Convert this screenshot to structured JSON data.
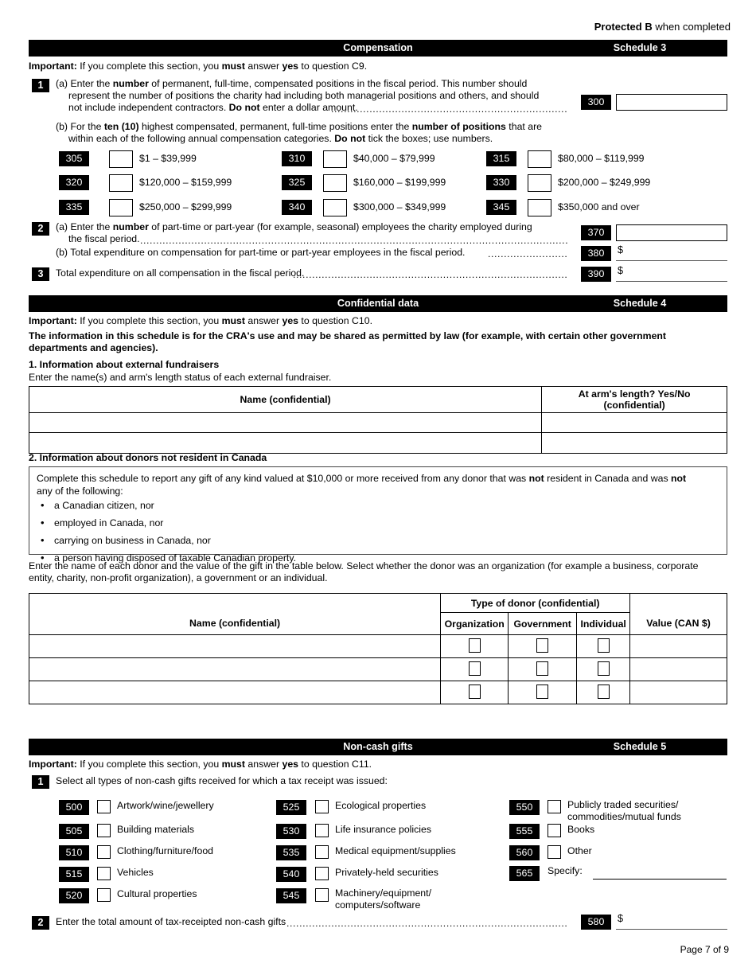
{
  "header": {
    "protected_bold": "Protected B",
    "protected_rest": " when completed"
  },
  "schedule3": {
    "bar_title": "Compensation",
    "bar_right": "Schedule 3",
    "important_bold": "Important:",
    "important_text_1": " If you complete this section, you ",
    "important_must": "must",
    "important_text_2": " answer ",
    "important_yes": "yes",
    "important_text_3": " to question C9.",
    "q1_marker": "1",
    "q1a_line1_pre": "(a) Enter the ",
    "q1a_number": "number",
    "q1a_line1_post": " of permanent, full-time, compensated positions in the fiscal period. This number should",
    "q1a_line2": "represent the number of positions the charity had including both managerial positions and others, and should",
    "q1a_line3_pre": "not include independent contractors. ",
    "q1a_donot": "Do not",
    "q1a_line3_post": " enter a dollar amount.",
    "q1a_code": "300",
    "q1b_line1_pre": "(b) For the ",
    "q1b_ten": "ten (10)",
    "q1b_line1_mid": " highest compensated, permanent, full-time positions enter the ",
    "q1b_numpos": "number of positions",
    "q1b_line1_post": " that are",
    "q1b_line2_pre": "within each of the following annual compensation categories. ",
    "q1b_donot": "Do not",
    "q1b_line2_post": " tick the boxes; use numbers.",
    "brackets": [
      {
        "code": "305",
        "label": "$1 – $39,999"
      },
      {
        "code": "310",
        "label": "$40,000 – $79,999"
      },
      {
        "code": "315",
        "label": "$80,000 – $119,999"
      },
      {
        "code": "320",
        "label": "$120,000 – $159,999"
      },
      {
        "code": "325",
        "label": "$160,000 – $199,999"
      },
      {
        "code": "330",
        "label": "$200,000 – $249,999"
      },
      {
        "code": "335",
        "label": "$250,000 – $299,999"
      },
      {
        "code": "340",
        "label": "$300,000 – $349,999"
      },
      {
        "code": "345",
        "label": "$350,000 and over"
      }
    ],
    "q2_marker": "2",
    "q2a_line1_pre": "(a) Enter the ",
    "q2a_number": "number",
    "q2a_line1_post": " of part-time or part-year (for example, seasonal) employees the charity employed during",
    "q2a_line2": "the fiscal period.",
    "q2a_code": "370",
    "q2b_text": "(b) Total expenditure on compensation for part-time or part-year employees in the fiscal period.",
    "q2b_code": "380",
    "q2b_sign": "$",
    "q3_marker": "3",
    "q3_text": "Total expenditure on all compensation in the fiscal period.",
    "q3_code": "390",
    "q3_sign": "$"
  },
  "schedule4": {
    "bar_title": "Confidential data",
    "bar_right": "Schedule 4",
    "important_bold": "Important:",
    "important_text_1": " If you complete this section, you ",
    "important_must": "must",
    "important_text_2": " answer ",
    "important_yes": "yes",
    "important_text_3": " to question C10.",
    "cra_notice_line1": "The information in this schedule is for the CRA's use and may be shared as permitted by law (for example, with certain other government",
    "cra_notice_line2": "departments and agencies).",
    "section1_heading": "1. Information about external fundraisers",
    "section1_sub": "Enter the name(s) and arm's length status of each external fundraiser.",
    "fundraiser_table": {
      "col_name": "Name (confidential)",
      "col_arms_line1": "At arm's length? Yes/No",
      "col_arms_line2": "(confidential)",
      "rows": [
        {
          "name": "",
          "arms": ""
        },
        {
          "name": "",
          "arms": ""
        }
      ]
    },
    "section2_heading": "2. Information about donors not resident in Canada",
    "donor_box": {
      "intro_pre": "Complete this schedule to report any gift of any kind valued at $10,000 or more received from any donor that was ",
      "intro_not1": "not",
      "intro_mid": " resident in Canada and was ",
      "intro_not2": "not",
      "intro_line2": "any of the following:",
      "bullets": [
        "a Canadian citizen, nor",
        "employed in Canada, nor",
        "carrying on business in Canada, nor",
        "a person having disposed of taxable Canadian property."
      ]
    },
    "donor_instructions_line1": "Enter the name of each donor and the value of the gift in the table below. Select whether the donor was an organization (for example a business, corporate",
    "donor_instructions_line2": "entity, charity, non-profit organization), a government or an individual.",
    "donor_table": {
      "group_header": "Type of donor (confidential)",
      "col_name": "Name (confidential)",
      "col_organization": "Organization",
      "col_government": "Government",
      "col_individual": "Individual",
      "col_value": "Value (CAN $)",
      "rows": [
        {
          "name": "",
          "organization": false,
          "government": false,
          "individual": false,
          "value": ""
        },
        {
          "name": "",
          "organization": false,
          "government": false,
          "individual": false,
          "value": ""
        },
        {
          "name": "",
          "organization": false,
          "government": false,
          "individual": false,
          "value": ""
        }
      ]
    }
  },
  "schedule5": {
    "bar_title": "Non-cash gifts",
    "bar_right": "Schedule 5",
    "important_bold": "Important:",
    "important_text_1": " If you complete this section, you ",
    "important_must": "must",
    "important_text_2": " answer ",
    "important_yes": "yes",
    "important_text_3": " to question C11.",
    "q1_marker": "1",
    "q1_text": "Select all types of non-cash gifts received for which a tax receipt was issued:",
    "col1": [
      {
        "code": "500",
        "label": "Artwork/wine/jewellery",
        "checked": false
      },
      {
        "code": "505",
        "label": "Building materials",
        "checked": false
      },
      {
        "code": "510",
        "label": "Clothing/furniture/food",
        "checked": false
      },
      {
        "code": "515",
        "label": "Vehicles",
        "checked": false
      },
      {
        "code": "520",
        "label": "Cultural properties",
        "checked": false
      }
    ],
    "col2": [
      {
        "code": "525",
        "label": "Ecological properties",
        "checked": false
      },
      {
        "code": "530",
        "label": "Life insurance policies",
        "checked": false
      },
      {
        "code": "535",
        "label": "Medical equipment/supplies",
        "checked": false
      },
      {
        "code": "540",
        "label": "Privately-held securities",
        "checked": false
      },
      {
        "code": "545",
        "label": "Machinery/equipment/\ncomputers/software",
        "checked": false
      }
    ],
    "col3": [
      {
        "code": "550",
        "label": "Publicly traded securities/\ncommodities/mutual funds",
        "checked": false
      },
      {
        "code": "555",
        "label": "Books",
        "checked": false
      },
      {
        "code": "560",
        "label": "Other",
        "checked": false
      }
    ],
    "specify_code": "565",
    "specify_label": "Specify:",
    "specify_value": "",
    "q2_marker": "2",
    "q2_text": "Enter the total amount of tax-receipted non-cash gifts",
    "q2_code": "580",
    "q2_sign": "$"
  },
  "footer": {
    "page": "Page 7 of 9"
  }
}
